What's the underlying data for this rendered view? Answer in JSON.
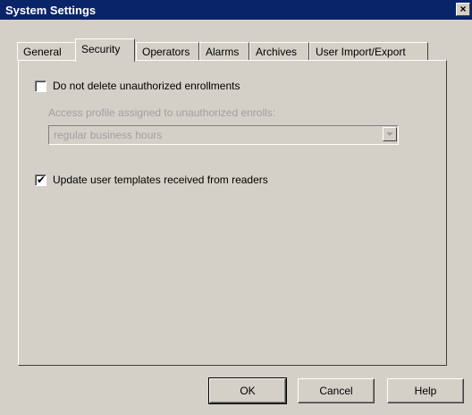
{
  "window": {
    "title": "System Settings",
    "close_glyph": "×"
  },
  "tabs": [
    {
      "label": "General",
      "active": false
    },
    {
      "label": "Security",
      "active": true
    },
    {
      "label": "Operators",
      "active": false
    },
    {
      "label": "Alarms",
      "active": false
    },
    {
      "label": "Archives",
      "active": false
    },
    {
      "label": "User Import/Export",
      "active": false
    }
  ],
  "security": {
    "no_delete_checkbox": {
      "label": "Do not delete unauthorized enrollments",
      "checked": false
    },
    "access_profile_label": "Access profile assigned to unauthorized enrolls:",
    "access_profile_combo": {
      "value": "regular business hours",
      "enabled": false
    },
    "update_templates_checkbox": {
      "label": "Update user templates received from readers",
      "checked": true
    },
    "checkmark_glyph": "✔"
  },
  "buttons": {
    "ok": "OK",
    "cancel": "Cancel",
    "help": "Help"
  },
  "colors": {
    "titlebar": "#0a246a",
    "face": "#d4d0c8",
    "disabled_text": "#a0a0a0"
  }
}
